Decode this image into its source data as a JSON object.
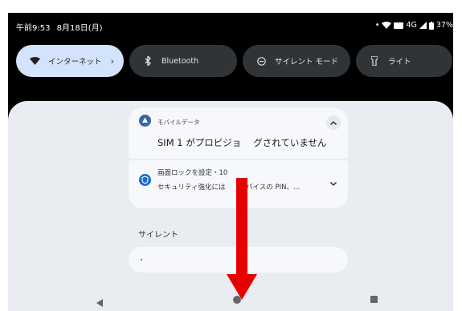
{
  "status_bar": {
    "time": "午前9:53",
    "date": "8月18日(月)",
    "network": "4G",
    "battery": "37%"
  },
  "quick_settings": [
    {
      "label": "インターネット",
      "icon": "wifi-icon",
      "active": true
    },
    {
      "label": "Bluetooth",
      "icon": "bluetooth-icon",
      "active": false
    },
    {
      "label": "サイレント モード",
      "icon": "do-not-disturb-icon",
      "active": false
    },
    {
      "label": "ライト",
      "icon": "flashlight-icon",
      "active": false
    }
  ],
  "notifications": [
    {
      "app": "モバイルデータ",
      "title": "SIM 1 がプロビジョ",
      "title_tail": "グされていません",
      "icon": "mobile-data-icon",
      "color": "#3a63a8"
    },
    {
      "app": "画面ロックを設定・10",
      "body": "セキュリティ強化には",
      "body_tail": "デバイスの PIN、...",
      "icon": "shield-icon",
      "color": "#1a6bd4"
    }
  ],
  "section": {
    "silent_label": "サイレント"
  },
  "colors": {
    "overlay_arrow": "#e60000",
    "active_tile": "#d3e3fd",
    "panel": "#e9edf1"
  }
}
